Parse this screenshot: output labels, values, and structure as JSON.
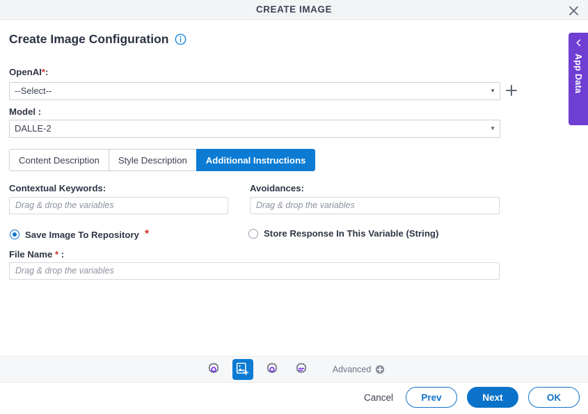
{
  "window": {
    "title": "CREATE IMAGE",
    "close_icon": "close-icon"
  },
  "header": {
    "page_title": "Create Image Configuration",
    "info_icon": "info-icon"
  },
  "form": {
    "openai": {
      "label": "OpenAI",
      "required_marker": "*",
      "label_suffix": ":",
      "selected": "--Select--",
      "caret_icon": "chevron-down-icon",
      "add_icon": "plus-icon"
    },
    "model": {
      "label": "Model :",
      "selected": "DALLE-2",
      "caret_icon": "chevron-down-icon"
    },
    "tabs": [
      {
        "label": "Content Description",
        "active": false
      },
      {
        "label": "Style Description",
        "active": false
      },
      {
        "label": "Additional Instructions",
        "active": true
      }
    ],
    "contextual_keywords": {
      "label": "Contextual Keywords:",
      "value": "",
      "placeholder": "Drag & drop the variables"
    },
    "avoidances": {
      "label": "Avoidances:",
      "value": "",
      "placeholder": "Drag & drop the variables"
    },
    "output_option": {
      "save_to_repository": {
        "label": "Save Image To Repository",
        "required_marker": "*",
        "selected": true
      },
      "store_in_variable": {
        "label": "Store Response In This Variable (String)",
        "selected": false
      }
    },
    "file_name": {
      "label": "File Name",
      "required_marker": "*",
      "label_suffix": ":",
      "value": "",
      "placeholder": "Drag & drop the variables"
    }
  },
  "toolbar": {
    "buttons": [
      {
        "icon": "gear-icon",
        "active": false
      },
      {
        "icon": "add-image-icon",
        "active": true
      },
      {
        "icon": "gear-icon",
        "active": false
      },
      {
        "icon": "gear-settings-lines-icon",
        "active": false
      }
    ],
    "advanced_label": "Advanced",
    "advanced_icon": "plus-circle-icon"
  },
  "actions": {
    "cancel": "Cancel",
    "prev": "Prev",
    "next": "Next",
    "ok": "OK"
  },
  "app_data_panel": {
    "label": "App Data",
    "chevron_icon": "chevron-left-icon"
  },
  "colors": {
    "accent_blue": "#0b7bd4",
    "primary_blue": "#0b72c9",
    "purple": "#6f3fd4",
    "icon_purple": "#7b2ff2",
    "required_red": "#d0342c",
    "toolbar_bg": "#f6f7f9",
    "titlebar_bg": "#f3f4f6"
  }
}
